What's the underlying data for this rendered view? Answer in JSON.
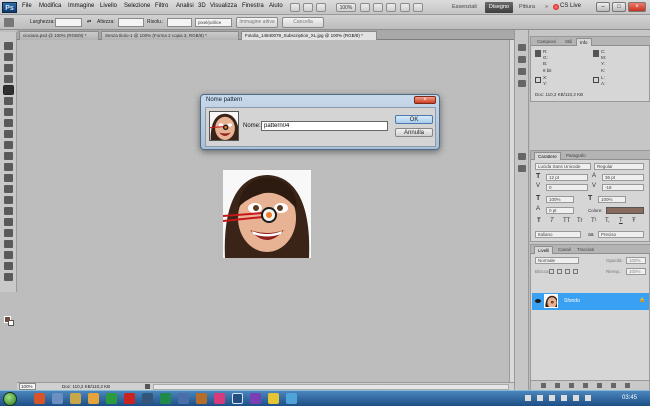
{
  "app": {
    "logo": "Ps"
  },
  "menu": [
    "File",
    "Modifica",
    "Immagine",
    "Livello",
    "Selezione",
    "Filtro",
    "Analisi",
    "3D",
    "Visualizza",
    "Finestra",
    "Aiuto"
  ],
  "zoom_menu": "100%",
  "workspaces": [
    "Essenziali",
    "Disegno",
    "Pittura"
  ],
  "workspace_active": "Disegno",
  "workspace_more": "»",
  "cs_live": "CS Live",
  "window_buttons": {
    "minimize": "–",
    "maximize": "□",
    "close": "×"
  },
  "options": {
    "width_label": "Larghezza:",
    "height_label": "Altezza:",
    "resolution_label": "Risolu.:",
    "unit": "pixel/pollice",
    "front_image": "Immagine attiva",
    "clear": "Cancella"
  },
  "tabs": [
    "ciociara.psd @ 100% (RGB/8) *",
    "Senza titolo-1 @ 100% (Forma 2 copia 3, RGB/8) *",
    "Fotolia_14840079_Subscription_XL.jpg @ 100% (RGB/8) *"
  ],
  "status": {
    "zoom": "100%",
    "doc": "Doc: 110,2 KB/110,2 KB"
  },
  "dialog": {
    "title": "Nome pattern",
    "close": "×",
    "name_label": "Nome:",
    "name_value": "pattern04",
    "ok": "OK",
    "cancel": "Annulla"
  },
  "info_panel": {
    "tabs": [
      "Campioni",
      "Stili",
      "Info"
    ],
    "rows": [
      [
        "R:",
        "C:"
      ],
      [
        "G:",
        "M:"
      ],
      [
        "B:",
        "Y:"
      ],
      [
        "8 bit",
        "K:"
      ]
    ],
    "rows2": [
      [
        "X:",
        "L:"
      ],
      [
        "Y:",
        "A:"
      ]
    ],
    "doc": "Doc: 110,2 KB/110,2 KB"
  },
  "character_panel": {
    "tabs": [
      "Carattere",
      "Paragrafo"
    ],
    "font": "Lucida Sans Unicode",
    "style": "Regular",
    "size": "12 pt",
    "leading": "36 pt",
    "kerning": "0",
    "tracking": "-18",
    "vscale": "100%",
    "hscale": "100%",
    "baseline": "0 pt",
    "color_label": "Colore:",
    "color": "#8b6a5e",
    "type_buttons": [
      "T",
      "T",
      "TT",
      "Tr",
      "T¹",
      "T,",
      "T",
      "Ŧ"
    ],
    "language": "Italiano",
    "aa_icon": "aa",
    "antialias": "Preciso"
  },
  "layers_panel": {
    "tabs": [
      "Livelli",
      "Canali",
      "Tracciati"
    ],
    "blend": "Normale",
    "opacity_label": "Opacità:",
    "opacity": "100%",
    "lock_label": "Blocca:",
    "fill_label": "Riemp.:",
    "fill": "100%",
    "layer": "Sfondo",
    "lock_icon": "🔒"
  },
  "clock": "03:45"
}
